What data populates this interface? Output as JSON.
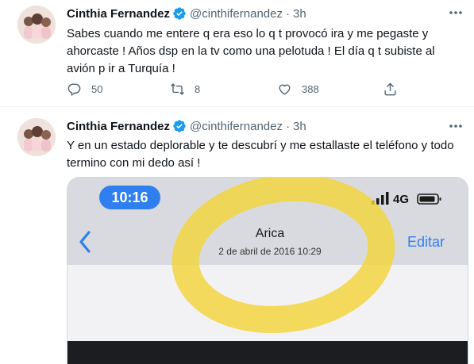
{
  "tweets": [
    {
      "author_name": "Cinthia Fernandez",
      "handle": "@cinthifernandez",
      "separator": "·",
      "time": "3h",
      "text": "Sabes cuando me entere q era eso lo q t provocó ira y me pegaste y ahorcaste ! Años dsp en la tv como una pelotuda ! El día q t subiste al avión p ir a Turquía !",
      "reply_count": "50",
      "retweet_count": "8",
      "like_count": "388"
    },
    {
      "author_name": "Cinthia Fernandez",
      "handle": "@cinthifernandez",
      "separator": "·",
      "time": "3h",
      "text": "Y en un estado deplorable y te descubrí y me estallaste el teléfono y todo termino con mi dedo así !",
      "media": {
        "status_time": "10:16",
        "network": "4G",
        "contact_name": "Arica",
        "date": "2 de abril de 2016 10:29",
        "edit_label": "Editar"
      }
    }
  ],
  "colors": {
    "accent_blue": "#1d9bf0",
    "secondary_text": "#536471",
    "highlight_yellow": "#f3d43c",
    "ios_blue": "#2f7ff0"
  },
  "icons": [
    "verified-badge-icon",
    "more-icon",
    "reply-icon",
    "retweet-icon",
    "like-icon",
    "share-icon",
    "back-chevron-icon",
    "signal-icon",
    "battery-icon"
  ]
}
